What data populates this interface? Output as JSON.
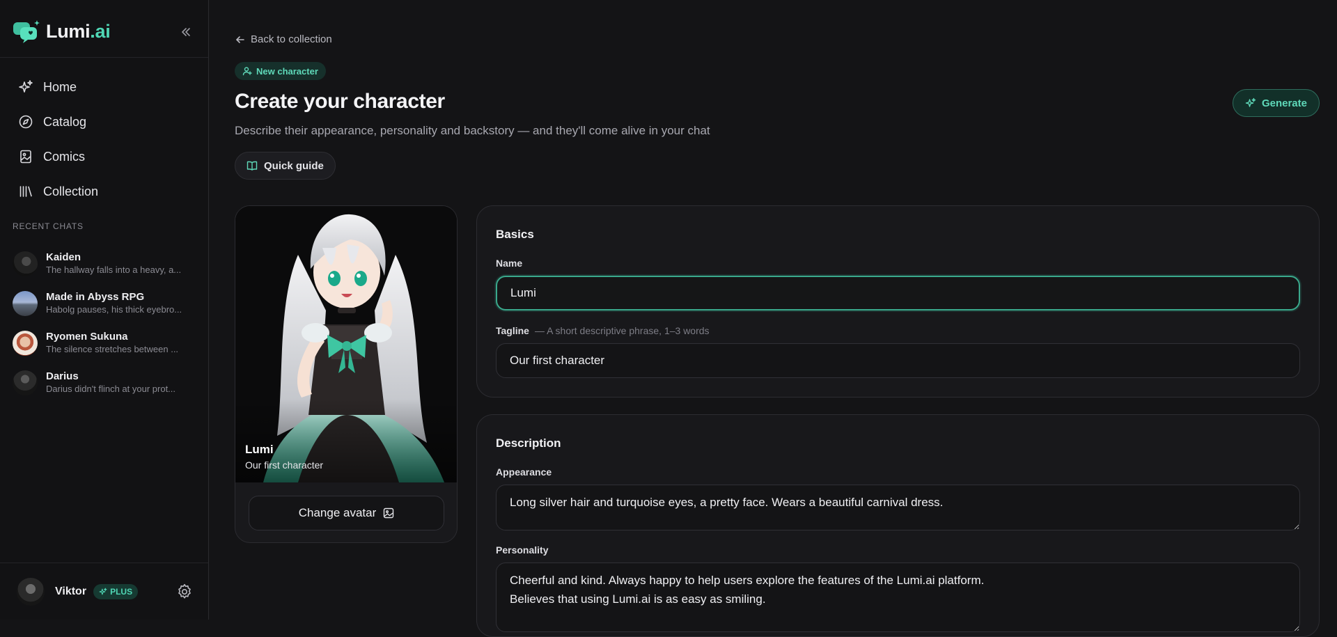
{
  "brand": {
    "name_main": "Lumi",
    "name_accent": ".ai",
    "accent_color": "#4fd6b4"
  },
  "sidebar": {
    "collapse_icon": "double-chevron-left-icon",
    "nav": [
      {
        "label": "Home",
        "icon": "sparkles-icon"
      },
      {
        "label": "Catalog",
        "icon": "compass-icon"
      },
      {
        "label": "Comics",
        "icon": "image-frame-icon"
      },
      {
        "label": "Collection",
        "icon": "library-icon"
      }
    ],
    "recent_label": "RECENT CHATS",
    "recent_chats": [
      {
        "name": "Kaiden",
        "preview": "The hallway falls into a heavy, a..."
      },
      {
        "name": "Made in Abyss RPG",
        "preview": "Habolg pauses, his thick eyebro..."
      },
      {
        "name": "Ryomen Sukuna",
        "preview": "The silence stretches between ..."
      },
      {
        "name": "Darius",
        "preview": "Darius didn't flinch at your prot..."
      }
    ],
    "user": {
      "name": "Viktor",
      "badge": "PLUS"
    }
  },
  "main": {
    "back_link": "Back to collection",
    "badge": "New character",
    "title": "Create your character",
    "subtitle": "Describe their appearance, personality and backstory — and they'll come alive in your chat",
    "guide_button": "Quick guide",
    "generate_button": "Generate"
  },
  "preview": {
    "name": "Lumi",
    "tagline": "Our first character",
    "change_avatar_button": "Change avatar"
  },
  "basics": {
    "title": "Basics",
    "name_label": "Name",
    "name_value": "Lumi",
    "tagline_label": "Tagline",
    "tagline_hint": "— A short descriptive phrase, 1–3 words",
    "tagline_value": "Our first character"
  },
  "description": {
    "title": "Description",
    "appearance_label": "Appearance",
    "appearance_value": "Long silver hair and turquoise eyes, a pretty face. Wears a beautiful carnival dress.",
    "personality_label": "Personality",
    "personality_value": "Cheerful and kind. Always happy to help users explore the features of the Lumi.ai platform.\nBelieves that using Lumi.ai is as easy as smiling."
  }
}
